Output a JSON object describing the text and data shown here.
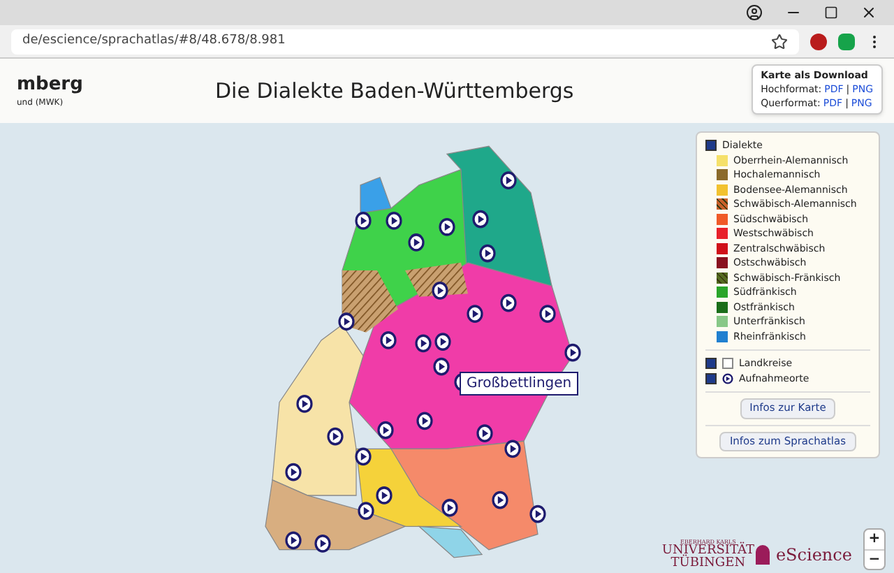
{
  "browser": {
    "url": "de/escience/sprachatlas/#8/48.678/8.981"
  },
  "header": {
    "site_title": "mberg",
    "site_subtitle": "und (MWK)",
    "page_title": "Die Dialekte Baden-Württembergs"
  },
  "download": {
    "title": "Karte als Download",
    "rows": [
      {
        "label": "Hochformat:",
        "links": [
          "PDF",
          "PNG"
        ],
        "separator": "|"
      },
      {
        "label": "Querformat:",
        "links": [
          "PDF",
          "PNG"
        ],
        "separator": "|"
      }
    ]
  },
  "map": {
    "tooltip": "Großbettlingen"
  },
  "legend": {
    "group": {
      "label": "Dialekte",
      "checked": true
    },
    "items": [
      {
        "label": "Oberrhein-Alemannisch",
        "color": "#f5e06a",
        "kind": "solid"
      },
      {
        "label": "Hochalemannisch",
        "color": "#8b6a2b",
        "kind": "solid"
      },
      {
        "label": "Bodensee-Alemannisch",
        "color": "#f2c230",
        "kind": "solid"
      },
      {
        "label": "Schwäbisch-Alemannisch",
        "color": "#c8602a",
        "kind": "hatched"
      },
      {
        "label": "Südschwäbisch",
        "color": "#f05a28",
        "kind": "solid"
      },
      {
        "label": "Westschwäbisch",
        "color": "#e8202a",
        "kind": "solid"
      },
      {
        "label": "Zentralschwäbisch",
        "color": "#d0101a",
        "kind": "solid"
      },
      {
        "label": "Ostschwäbisch",
        "color": "#8a1020",
        "kind": "solid"
      },
      {
        "label": "Schwäbisch-Fränkisch",
        "color": "#556b20",
        "kind": "hatched"
      },
      {
        "label": "Südfränkisch",
        "color": "#2aa52a",
        "kind": "solid"
      },
      {
        "label": "Ostfränkisch",
        "color": "#1a6e1a",
        "kind": "solid"
      },
      {
        "label": "Unterfränkisch",
        "color": "#88c888",
        "kind": "solid"
      },
      {
        "label": "Rheinfränkisch",
        "color": "#2080d0",
        "kind": "solid"
      }
    ],
    "layers": [
      {
        "label": "Landkreise",
        "checked": true,
        "kind": "box"
      },
      {
        "label": "Aufnahmeorte",
        "checked": true,
        "kind": "marker"
      }
    ],
    "buttons": [
      "Infos zur Karte",
      "Infos zum Sprachatlas"
    ]
  },
  "logos": {
    "university": [
      "EBERHARD KARLS",
      "UNIVERSITÄT",
      "TÜBINGEN"
    ],
    "escience": "eScience"
  },
  "zoom": {
    "in": "+",
    "out": "−"
  }
}
